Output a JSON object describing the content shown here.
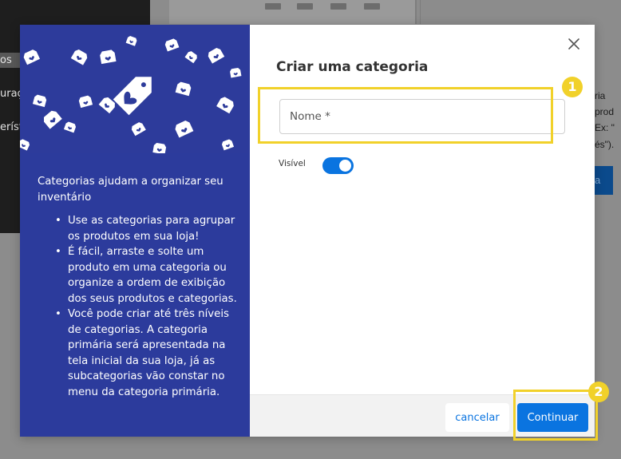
{
  "background": {
    "left_menu_items": [
      "os",
      "uraç",
      "eríst"
    ],
    "right_text_lines": [
      "ria",
      "prod",
      "Ex: \"",
      "és\")."
    ],
    "right_button_label": "a"
  },
  "modal": {
    "title": "Criar uma categoria",
    "close_icon": "close-icon",
    "name_field": {
      "placeholder": "Nome *",
      "value": ""
    },
    "visible_label": "Visível",
    "visible_toggle_on": true,
    "cancel_label": "cancelar",
    "continue_label": "Continuar",
    "accent_color": "#0a74e0",
    "left_panel": {
      "bg_color": "#2c3b9c",
      "hero_icon": "price-tag-heart-icon",
      "intro": "Categorias ajudam a organizar seu inventário",
      "bullets": [
        "Use as categorias para agrupar os produtos em sua loja!",
        "É fácil, arraste e solte um produto em uma categoria ou organize a ordem de exibição dos seus produtos e categorias.",
        "Você pode criar até três níveis de categorias. A categoria primária será apresentada na tela inicial da sua loja, já as subcategorias vão constar no menu da categoria primária."
      ]
    }
  },
  "annotations": {
    "highlight_color": "#f1d12a",
    "badge_1": "1",
    "badge_2": "2"
  }
}
